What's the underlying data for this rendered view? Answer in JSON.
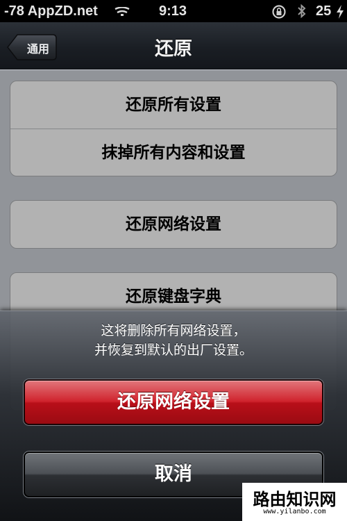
{
  "status_bar": {
    "carrier": "-78 AppZD.net",
    "time": "9:13",
    "battery": "25",
    "icons": [
      "wifi-icon",
      "rotation-lock-icon",
      "bluetooth-icon",
      "charging-icon"
    ]
  },
  "nav": {
    "back_label": "通用",
    "title": "还原"
  },
  "settings": {
    "reset_all": "还原所有设置",
    "erase_all": "抹掉所有内容和设置",
    "reset_network": "还原网络设置",
    "reset_keyboard": "还原键盘字典"
  },
  "action_sheet": {
    "message_line1": "这将删除所有网络设置，",
    "message_line2": "并恢复到默认的出厂设置。",
    "confirm_label": "还原网络设置",
    "cancel_label": "取消"
  },
  "watermark": {
    "main": "路由知识网",
    "sub": "www.yilanbo.com"
  },
  "colors": {
    "destructive": "#c81a24",
    "nav_bg": "#1a1e24",
    "cell_bg": "#f7f7f7"
  }
}
